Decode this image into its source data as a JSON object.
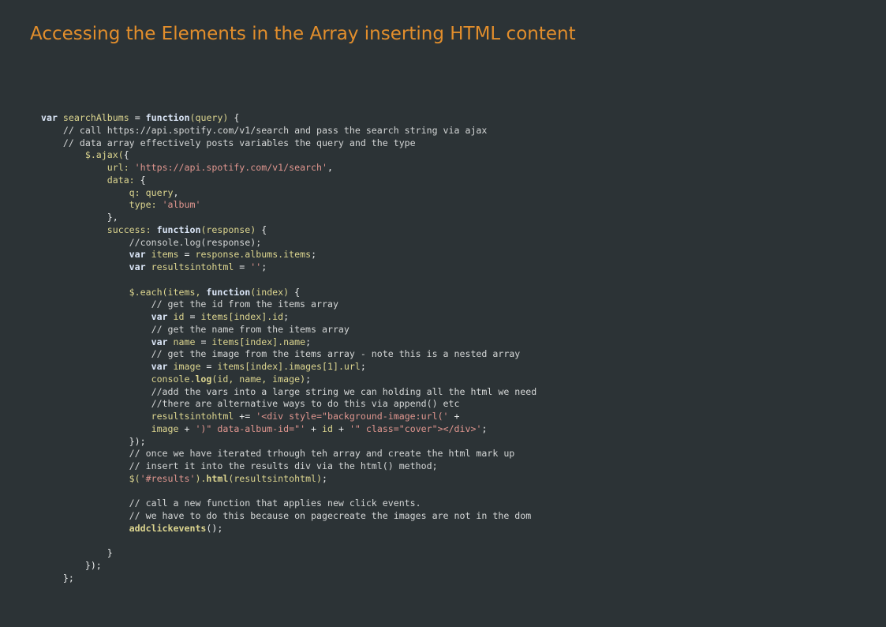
{
  "slide": {
    "title": "Accessing the Elements in the Array inserting HTML content",
    "colors": {
      "background": "#2c3336",
      "title": "#e28e2c",
      "keyword": "#dbe6f7",
      "identifier": "#dcd58f",
      "string": "#e0968f",
      "comment": "#d4d6d6"
    }
  },
  "code": {
    "language": "javascript",
    "lines": [
      [
        [
          "k",
          "var"
        ],
        [
          "i",
          " searchAlbums "
        ],
        [
          "p",
          "= "
        ],
        [
          "k",
          "function"
        ],
        [
          "i",
          "(query) "
        ],
        [
          "p",
          "{"
        ]
      ],
      [
        [
          "c",
          "    // call https://api.spotify.com/v1/search and pass the search string via ajax"
        ]
      ],
      [
        [
          "c",
          "    // data array effectively posts variables the query and the type"
        ]
      ],
      [
        [
          "i",
          "        $.ajax("
        ],
        [
          "p",
          "{"
        ]
      ],
      [
        [
          "i",
          "            url: "
        ],
        [
          "s",
          "'https://api.spotify.com/v1/search'"
        ],
        [
          "p",
          ","
        ]
      ],
      [
        [
          "i",
          "            data: "
        ],
        [
          "p",
          "{"
        ]
      ],
      [
        [
          "i",
          "                q: query"
        ],
        [
          "p",
          ","
        ]
      ],
      [
        [
          "i",
          "                type: "
        ],
        [
          "s",
          "'album'"
        ]
      ],
      [
        [
          "p",
          "            },"
        ]
      ],
      [
        [
          "i",
          "            success: "
        ],
        [
          "k",
          "function"
        ],
        [
          "i",
          "(response) "
        ],
        [
          "p",
          "{"
        ]
      ],
      [
        [
          "c",
          "                //console.log(response);"
        ]
      ],
      [
        [
          "k",
          "                var"
        ],
        [
          "i",
          " items "
        ],
        [
          "p",
          "= "
        ],
        [
          "i",
          "response.albums.items"
        ],
        [
          "p",
          ";"
        ]
      ],
      [
        [
          "k",
          "                var"
        ],
        [
          "i",
          " resultsintohtml "
        ],
        [
          "p",
          "= "
        ],
        [
          "s",
          "''"
        ],
        [
          "p",
          ";"
        ]
      ],
      [],
      [
        [
          "i",
          "                $.each(items, "
        ],
        [
          "k",
          "function"
        ],
        [
          "i",
          "(index) "
        ],
        [
          "p",
          "{"
        ]
      ],
      [
        [
          "c",
          "                    // get the id from the items array"
        ]
      ],
      [
        [
          "k",
          "                    var"
        ],
        [
          "i",
          " id "
        ],
        [
          "p",
          "= "
        ],
        [
          "i",
          "items[index].id"
        ],
        [
          "p",
          ";"
        ]
      ],
      [
        [
          "c",
          "                    // get the name from the items array"
        ]
      ],
      [
        [
          "k",
          "                    var"
        ],
        [
          "i",
          " name "
        ],
        [
          "p",
          "= "
        ],
        [
          "i",
          "items[index].name"
        ],
        [
          "p",
          ";"
        ]
      ],
      [
        [
          "c",
          "                    // get the image from the items array - note this is a nested array"
        ]
      ],
      [
        [
          "k",
          "                    var"
        ],
        [
          "i",
          " image "
        ],
        [
          "p",
          "= "
        ],
        [
          "i",
          "items[index].images[1].url"
        ],
        [
          "p",
          ";"
        ]
      ],
      [
        [
          "i",
          "                    console."
        ],
        [
          "b",
          "log"
        ],
        [
          "i",
          "(id, name, image)"
        ],
        [
          "p",
          ";"
        ]
      ],
      [
        [
          "c",
          "                    //add the vars into a large string we can holding all the html we need"
        ]
      ],
      [
        [
          "c",
          "                    //there are alternative ways to do this via append() etc"
        ]
      ],
      [
        [
          "i",
          "                    resultsintohtml "
        ],
        [
          "p",
          "+= "
        ],
        [
          "s",
          "'<div style=\"background-image:url('"
        ],
        [
          "p",
          " +"
        ]
      ],
      [
        [
          "i",
          "                    image "
        ],
        [
          "p",
          "+ "
        ],
        [
          "s",
          "')\" data-album-id=\"'"
        ],
        [
          "p",
          " + "
        ],
        [
          "i",
          "id"
        ],
        [
          "p",
          " + "
        ],
        [
          "s",
          "'\" class=\"cover\"></div>'"
        ],
        [
          "p",
          ";"
        ]
      ],
      [
        [
          "p",
          "                });"
        ]
      ],
      [
        [
          "c",
          "                // once we have iterated trhough teh array and create the html mark up"
        ]
      ],
      [
        [
          "c",
          "                // insert it into the results div via the html() method;"
        ]
      ],
      [
        [
          "i",
          "                $("
        ],
        [
          "s",
          "'#results'"
        ],
        [
          "i",
          ")."
        ],
        [
          "b",
          "html"
        ],
        [
          "i",
          "(resultsintohtml)"
        ],
        [
          "p",
          ";"
        ]
      ],
      [],
      [
        [
          "c",
          "                // call a new function that applies new click events."
        ]
      ],
      [
        [
          "c",
          "                // we have to do this because on pagecreate the images are not in the dom"
        ]
      ],
      [
        [
          "b",
          "                addclickevents"
        ],
        [
          "p",
          "();"
        ]
      ],
      [],
      [
        [
          "p",
          "            }"
        ]
      ],
      [
        [
          "p",
          "        });"
        ]
      ],
      [
        [
          "p",
          "    };"
        ]
      ]
    ]
  }
}
